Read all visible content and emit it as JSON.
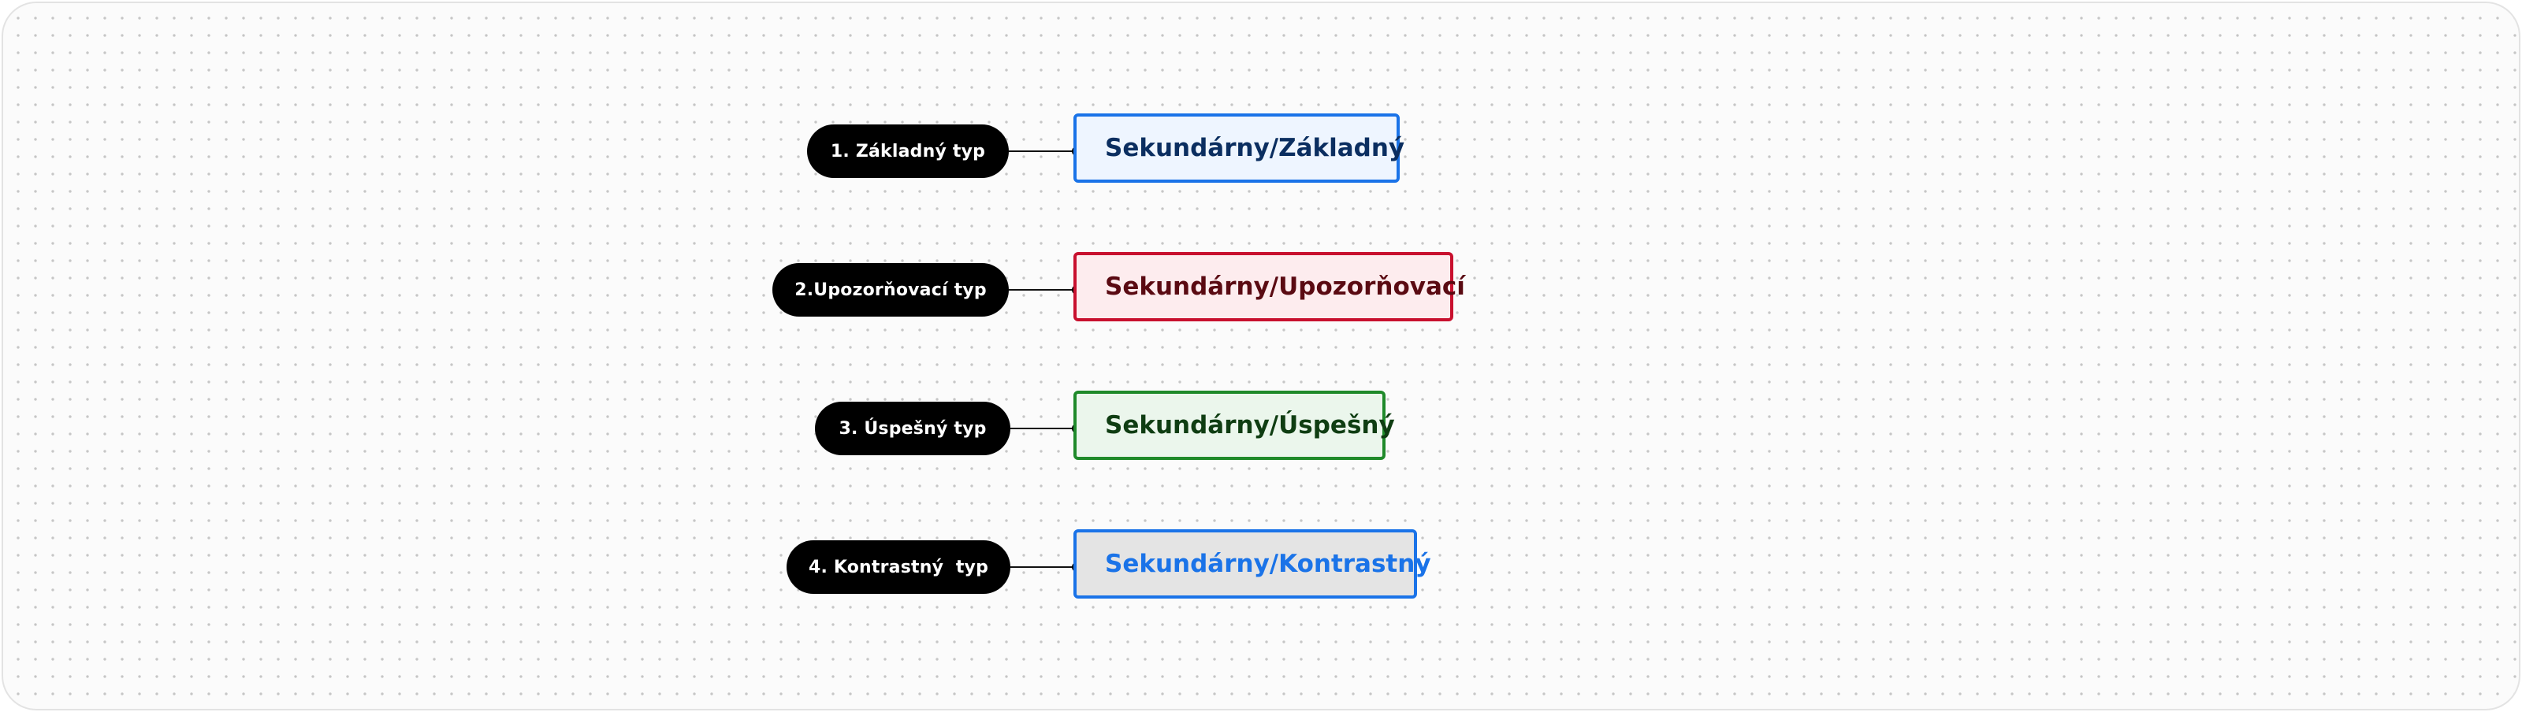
{
  "variants": [
    {
      "label": "1. Základný typ",
      "button_text": "Sekundárny/Základný",
      "style": "basic"
    },
    {
      "label": "2.Upozorňovací typ",
      "button_text": "Sekundárny/Upozorňovací",
      "style": "warning"
    },
    {
      "label": "3. Úspešný typ",
      "button_text": "Sekundárny/Úspešný",
      "style": "success"
    },
    {
      "label": "4. Kontrastný  typ",
      "button_text": "Sekundárny/Kontrastný",
      "style": "contrast"
    }
  ],
  "colors": {
    "basic_border": "#1a73e8",
    "basic_fill": "#eef5ff",
    "basic_text": "#0b2e60",
    "warning_border": "#c8102e",
    "warning_fill": "#fdecee",
    "warning_text": "#5a0a12",
    "success_border": "#1f8a2a",
    "success_fill": "#ebf6ec",
    "success_text": "#0f3d12",
    "contrast_border": "#1a73e8",
    "contrast_fill": "#e4e4e4",
    "contrast_text": "#1a73e8",
    "label_pill": "#000000"
  }
}
